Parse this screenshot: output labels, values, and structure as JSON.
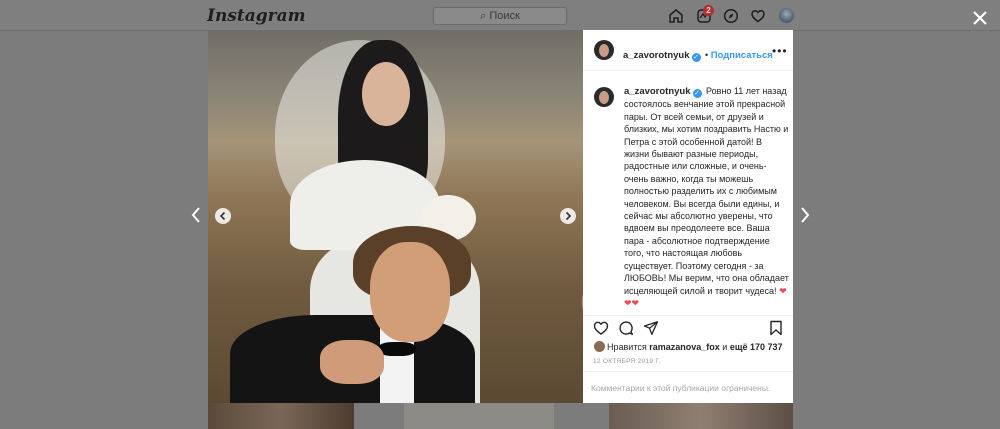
{
  "background": {
    "logo": "Instagram",
    "search_placeholder": "Поиск",
    "activity_badge": "2"
  },
  "post": {
    "username": "a_zavorotnyuk",
    "follow_label": "Подписаться",
    "more_label": "•••",
    "caption": "Ровно 11 лет назад состоялось венчание этой прекрасной пары. От всей семьи, от друзей и близких, мы хотим поздравить Настю и Петра с этой особенной датой! В жизни бывают разные периоды, радостные или сложные, и очень-очень важно, когда ты можешь полностью разделить их с любимым человеком. Вы всегда были едины, и сейчас мы абсолютно уверены, что вдвоем вы преодолеете все. Ваша пара - абсолютное подтверждение того, что настоящая любовь существует. Поэтому сегодня - за ЛЮБОВЬ! Мы верим, что она обладает исцеляющей силой и творит чудеса!",
    "caption_hearts": "❤❤❤",
    "likes_prefix": "Нравится",
    "likes_user": "ramazanova_fox",
    "likes_and": "и",
    "likes_more": "ещё 170 737",
    "date": "12 ОКТЯБРЯ 2019 Г.",
    "comments_notice": "Комментарии к этой публикации ограничены."
  },
  "colors": {
    "accent": "#3897f0",
    "heart": "#ed4956"
  },
  "icons": [
    "home-icon",
    "direct-icon",
    "explore-icon",
    "heart-icon",
    "close-icon",
    "chevron-left-icon",
    "chevron-right-icon",
    "comment-icon",
    "share-icon",
    "bookmark-icon",
    "verified-icon"
  ]
}
